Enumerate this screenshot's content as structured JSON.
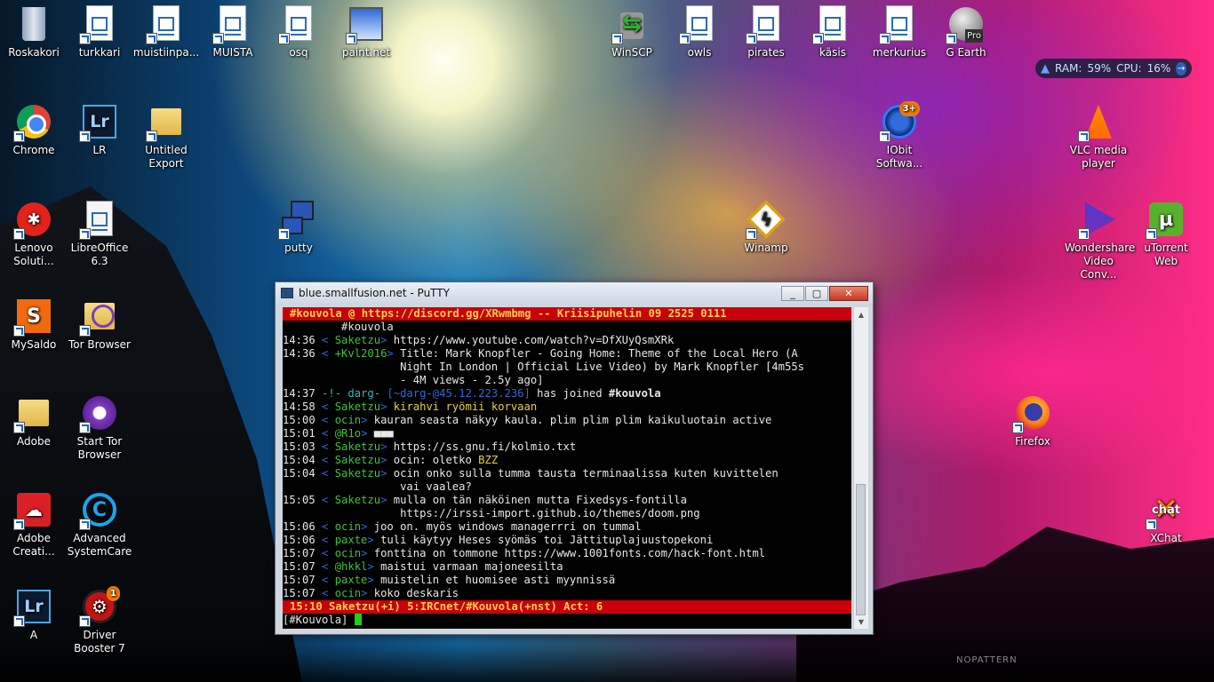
{
  "desktop_icons": [
    {
      "label": "Roskakori",
      "icon": "recycle-bin-icon"
    },
    {
      "label": "turkkari",
      "icon": "writer-doc-icon"
    },
    {
      "label": "muistiinpa...",
      "icon": "writer-doc-icon"
    },
    {
      "label": "MUISTA",
      "icon": "writer-doc-icon"
    },
    {
      "label": "osq",
      "icon": "writer-doc-icon"
    },
    {
      "label": "paint.net",
      "icon": "paintnet-icon"
    },
    {
      "label": "WinSCP",
      "icon": "winscp-icon"
    },
    {
      "label": "owls",
      "icon": "writer-doc-icon"
    },
    {
      "label": "pirates",
      "icon": "blank-doc-icon"
    },
    {
      "label": "käsis",
      "icon": "writer-doc-icon"
    },
    {
      "label": "merkurius",
      "icon": "writer-doc-icon"
    },
    {
      "label": "G Earth",
      "icon": "google-earth-icon",
      "badge": "Pro"
    },
    {
      "label": "Chrome",
      "icon": "chrome-icon"
    },
    {
      "label": "LR",
      "icon": "lightroom-icon",
      "glyph": "Lr"
    },
    {
      "label": "Untitled Export",
      "icon": "folder-icon"
    },
    {
      "label": "IObit Softwa...",
      "icon": "iobit-icon",
      "badge": "3+"
    },
    {
      "label": "VLC media player",
      "icon": "vlc-icon"
    },
    {
      "label": "Lenovo Soluti...",
      "icon": "lenovo-icon"
    },
    {
      "label": "LibreOffice 6.3",
      "icon": "libreoffice-icon"
    },
    {
      "label": "putty",
      "icon": "putty-icon"
    },
    {
      "label": "Winamp",
      "icon": "winamp-icon"
    },
    {
      "label": "Wondershare Video Conv...",
      "icon": "wondershare-icon"
    },
    {
      "label": "uTorrent Web",
      "icon": "utorrent-icon"
    },
    {
      "label": "MySaldo",
      "icon": "mysaldo-icon",
      "glyph": "S"
    },
    {
      "label": "Tor Browser",
      "icon": "tor-folder-icon"
    },
    {
      "label": "Adobe",
      "icon": "folder-icon"
    },
    {
      "label": "Start Tor Browser",
      "icon": "tor-icon"
    },
    {
      "label": "Firefox",
      "icon": "firefox-icon"
    },
    {
      "label": "Adobe Creati...",
      "icon": "adobe-cc-icon"
    },
    {
      "label": "Advanced SystemCare",
      "icon": "advanced-systemcare-icon",
      "glyph": "C"
    },
    {
      "label": "XChat",
      "icon": "xchat-icon",
      "glyph": "chat"
    },
    {
      "label": "A",
      "icon": "lightroom-icon",
      "glyph": "Lr"
    },
    {
      "label": "Driver Booster 7",
      "icon": "driver-booster-icon",
      "badge": "1"
    }
  ],
  "widget": {
    "ram_label": "RAM:",
    "ram": "59",
    "ram_unit": "%",
    "cpu_label": "CPU:",
    "cpu": "16",
    "cpu_unit": "%"
  },
  "putty": {
    "title": "blue.smallfusion.net - PuTTY",
    "min": "_",
    "max": "▢",
    "close": "✕",
    "topic": "#kouvola @ https://discord.gg/XRwmbmg -- Kriisipuhelin 09 2525 0111",
    "lines": [
      {
        "cont": "         #kouvola"
      },
      {
        "ts": "14:36",
        "nick": "Saketzu",
        "msg": "https://www.youtube.com/watch?v=DfXUyQsmXRk"
      },
      {
        "ts": "14:36",
        "nick": "+Kvl2016",
        "msg": "Title: Mark Knopfler - Going Home: Theme of the Local Hero (A"
      },
      {
        "cont": "                  Night In London | Official Live Video) by Mark Knopfler [4m55s"
      },
      {
        "cont": "                  - 4M views - 2.5y ago]"
      },
      {
        "join": true,
        "ts": "14:37",
        "pre": " -!- ",
        "nick": "darg-",
        "host": "[~darg-@45.12.223.236]",
        "msg": " has joined ",
        "chan": "#kouvola"
      },
      {
        "ts": "14:58",
        "nick": "Saketzu",
        "yellow": "kirahvi ryömii korvaan"
      },
      {
        "ts": "15:00",
        "nick": "ocin",
        "msg": "kauran seasta näkyy kaula. plim plim plim kaikuluotain active"
      },
      {
        "ts": "15:01",
        "nick": "@R1o",
        "msg": "■■■"
      },
      {
        "ts": "15:03",
        "nick": "Saketzu",
        "msg": "https://ss.gnu.fi/kolmio.txt"
      },
      {
        "ts": "15:04",
        "nick": "Saketzu",
        "msg": "ocin: oletko ",
        "yellow": "BZZ"
      },
      {
        "ts": "15:04",
        "nick": "Saketzu",
        "msg": "ocin onko sulla tumma tausta terminaalissa kuten kuvittelen"
      },
      {
        "cont": "                  vai vaalea?"
      },
      {
        "ts": "15:05",
        "nick": "Saketzu",
        "msg": "mulla on tän näköinen mutta Fixedsys-fontilla"
      },
      {
        "cont": "                  https://irssi-import.github.io/themes/doom.png"
      },
      {
        "ts": "15:06",
        "nick": "ocin",
        "msg": "joo on. myös windows managerrri on tummal"
      },
      {
        "ts": "15:06",
        "nick": "paxte",
        "msg": "tuli käytyy Heses syömäs toi Jättituplajuustopekoni"
      },
      {
        "ts": "15:07",
        "nick": "ocin",
        "msg": "fonttina on tommone https://www.1001fonts.com/hack-font.html"
      },
      {
        "ts": "15:07",
        "nick": "@hkkl",
        "msg": "maistui varmaan majoneesilta"
      },
      {
        "ts": "15:07",
        "nick": "paxte",
        "msg": "muistelin et huomisee asti myynnissä"
      },
      {
        "ts": "15:07",
        "nick": "ocin",
        "msg": "koko deskaris"
      }
    ],
    "status": "15:10 Saketzu(+i) 5:IRCnet/#Kouvola(+nst) Act: 6",
    "prompt": "[#Kouvola] "
  },
  "watermark": "NOPATTERN"
}
